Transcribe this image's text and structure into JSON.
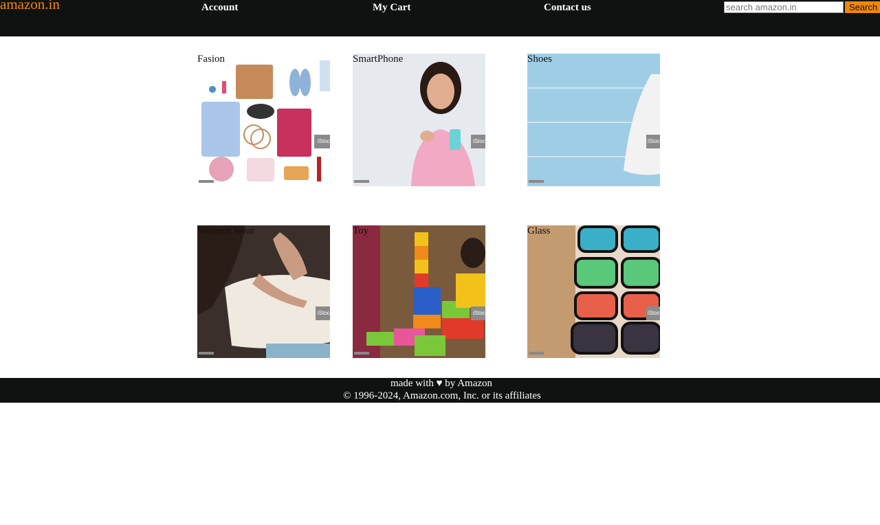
{
  "header": {
    "logo": "amazon.in",
    "nav": [
      "Account",
      "My Cart",
      "Contact us"
    ],
    "search_placeholder": "search amazon.in",
    "search_button": "Search",
    "accent_color": "#f08804",
    "bar_color": "#101211"
  },
  "categories": [
    {
      "label": "Fasion"
    },
    {
      "label": "SmartPhone"
    },
    {
      "label": "Shoes"
    },
    {
      "label": "Western Wear"
    },
    {
      "label": "Toy"
    },
    {
      "label": "Glass"
    }
  ],
  "watermark": "iStock",
  "footer": {
    "made_with_prefix": "made with ",
    "heart": "♥",
    "made_with_suffix": " by Amazon",
    "copyright": "© 1996-2024, Amazon.com, Inc. or its affiliates"
  }
}
